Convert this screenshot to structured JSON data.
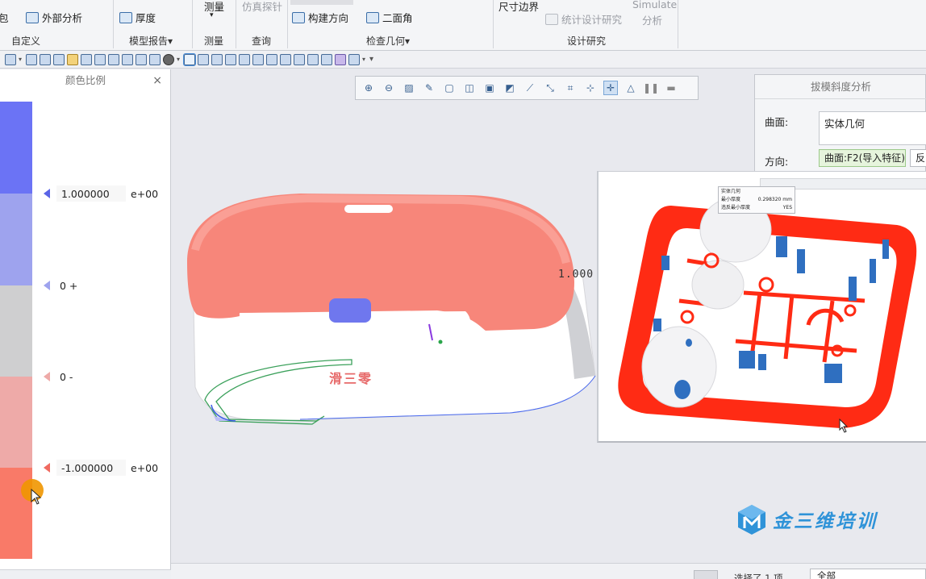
{
  "ribbon": {
    "frag_left": "包",
    "external_analysis": "外部分析",
    "customize_group": "自定义",
    "thickness": "厚度",
    "model_report_group": "模型报告",
    "measure_btn": "测量",
    "measure_group": "测量",
    "simulate_probe": "仿真探针",
    "query_group": "查询",
    "build_direction": "构建方向",
    "dihedral": "二面角",
    "inspect_geometry_group": "检查几何",
    "size_boundary": "尺寸边界",
    "stat_design_study": "统计设计研究",
    "simulate_line1": "Simulate",
    "simulate_line2": "分析",
    "design_study_group": "设计研究",
    "dropdown_glyph": "▾"
  },
  "color_scale_panel": {
    "title": "颜色比例",
    "close": "×",
    "markers": [
      {
        "value": "1.000000",
        "exp": "e+00"
      },
      {
        "value": "0 +"
      },
      {
        "value": "0 -"
      },
      {
        "value": "-1.000000",
        "exp": "e+00"
      }
    ],
    "colors": {
      "band1": "#6b73f5",
      "band2": "#9ea3ee",
      "band3": "#cfcfd0",
      "band4": "#eeaaa8",
      "band5": "#f97a68",
      "marker_blue": "#5a64e6",
      "marker_red": "#f06a60"
    }
  },
  "graphics": {
    "scale_label": "1.000",
    "model_text": "滑三零"
  },
  "draft_dialog": {
    "title": "拔模斜度分析",
    "surface_label": "曲面:",
    "surface_value": "实体几何",
    "direction_label": "方向:",
    "direction_value": "曲面:F2(导入特征)",
    "reverse": "反"
  },
  "inset_info": {
    "title": "实体几何",
    "min_thickness_label": "最小厚度",
    "min_thickness_value": "0.298320",
    "unit": "mm",
    "violation_label": "违反最小厚度",
    "violation_value": "YES"
  },
  "status_bar": {
    "selected": "选择了 1 项",
    "filter": "全部"
  },
  "watermark": {
    "text": "金三维培训"
  }
}
